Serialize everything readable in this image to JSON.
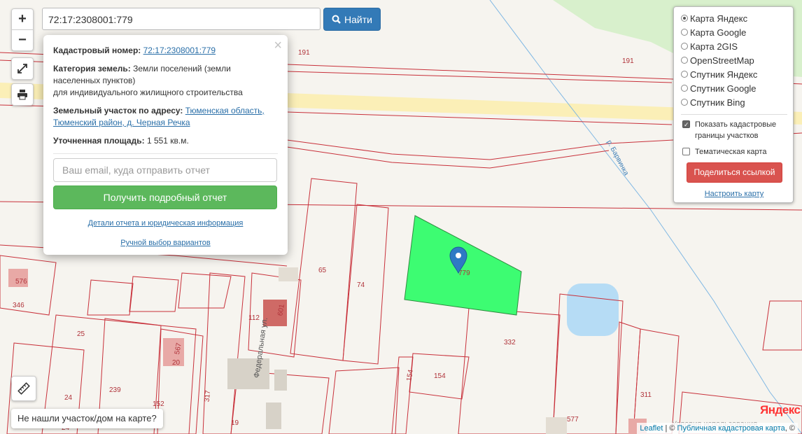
{
  "search": {
    "value": "72:17:2308001:779",
    "button_label": "Найти"
  },
  "zoom": {
    "in_label": "+",
    "out_label": "−"
  },
  "popup": {
    "cadastral_label": "Кадастровый номер:",
    "cadastral_value": "72:17:2308001:779",
    "category_label": "Категория земель:",
    "category_value": "Земли поселений (земли населенных пунктов)",
    "usage": "для индивидуального жилищного строительства",
    "address_label": "Земельный участок по адресу:",
    "address_value": "Тюменская область, Тюменский район, д. Черная Речка",
    "area_label": "Уточненная площадь:",
    "area_value": "1 551 кв.м.",
    "email_placeholder": "Ваш email, куда отправить отчет",
    "report_button": "Получить подробный отчет",
    "details_link": "Детали отчета и юридическая информация",
    "manual_link": "Ручной выбор вариантов",
    "close_label": "×"
  },
  "layers": {
    "options": [
      {
        "label": "Карта Яндекс",
        "selected": true
      },
      {
        "label": "Карта Google",
        "selected": false
      },
      {
        "label": "Карта 2GIS",
        "selected": false
      },
      {
        "label": "OpenStreetMap",
        "selected": false
      },
      {
        "label": "Спутник Яндекс",
        "selected": false
      },
      {
        "label": "Спутник Google",
        "selected": false
      },
      {
        "label": "Спутник Bing",
        "selected": false
      }
    ],
    "checkboxes": [
      {
        "label": "Показать кадастровые границы участков",
        "checked": true
      },
      {
        "label": "Тематическая карта",
        "checked": false
      }
    ],
    "share_button": "Поделиться ссылкой",
    "configure_link": "Настроить карту"
  },
  "not_found": "Не нашли участок/дом на карте?",
  "map": {
    "parcel_labels": [
      "191",
      "191",
      "65",
      "74",
      "779",
      "112",
      "601",
      "332",
      "25",
      "346",
      "576",
      "567",
      "20",
      "239",
      "154",
      "154",
      "311",
      "24",
      "152",
      "317",
      "19",
      "577",
      "24"
    ],
    "street_label": "Федеральная ул.",
    "river_label": "р. Барвинка",
    "yandex_logo": "Яндекс",
    "yandex_terms": "Условия использования",
    "attribution_leaflet": "Leaflet",
    "attribution_sep": " | © ",
    "attribution_pkk": "Публичная кадастровая карта",
    "attribution_end": ", ©"
  },
  "colors": {
    "parcel_line": "#c8303a",
    "selected_parcel": "#3dfc72",
    "road": "#fbeeb2",
    "water": "#b6dcf5",
    "forest": "#d7f0cb"
  }
}
